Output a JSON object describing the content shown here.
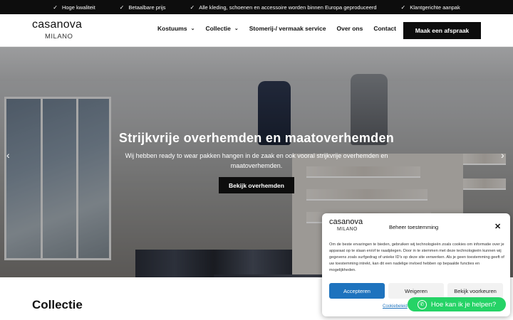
{
  "topbar": {
    "usps": [
      "Hoge kwaliteit",
      "Betaalbare prijs",
      "Alle kleding, schoenen en accessoire worden binnen Europa geproduceerd",
      "Klantgerichte aanpak"
    ],
    "check_icon": "✓"
  },
  "header": {
    "logo_brand": "casanova",
    "logo_sub": "MILANO",
    "nav": [
      {
        "label": "Kostuums",
        "has_dropdown": true
      },
      {
        "label": "Collectie",
        "has_dropdown": true
      },
      {
        "label": "Stomerij-/ vermaak service",
        "has_dropdown": false
      },
      {
        "label": "Over ons",
        "has_dropdown": false
      },
      {
        "label": "Contact",
        "has_dropdown": false
      }
    ],
    "chevron_icon": "⌄",
    "cta_label": "Maak een afspraak"
  },
  "hero": {
    "title": "Strijkvrije overhemden en maatoverhemden",
    "text": "Wij hebben ready to wear pakken hangen in de zaak en ook vooral strijkvrije overhemden en maatoverhemden.",
    "button_label": "Bekijk overhemden",
    "prev_icon": "‹",
    "next_icon": "›"
  },
  "collection": {
    "heading": "Collectie"
  },
  "cookie": {
    "logo_brand": "casanova",
    "logo_sub": "MILANO",
    "title": "Beheer toestemming",
    "close_icon": "✕",
    "text": "Om de beste ervaringen te bieden, gebruiken wij technologieën zoals cookies om informatie over je apparaat op te slaan en/of te raadplegen. Door in te stemmen met deze technologieën kunnen wij gegevens zoals surfgedrag of unieke ID's op deze site verwerken. Als je geen toestemming geeft of uw toestemming intrekt, kan dit een nadelige invloed hebben op bepaalde functies en mogelijkheden.",
    "accept_label": "Accepteren",
    "deny_label": "Weigeren",
    "prefs_label": "Bekijk voorkeuren",
    "link_label": "Cookiebeleid"
  },
  "whatsapp": {
    "label": "Hoe kan ik je helpen?",
    "icon": "✆"
  },
  "colors": {
    "accent_blue": "#1e73be",
    "whatsapp_green": "#25d366",
    "dark": "#0d0d0d"
  }
}
